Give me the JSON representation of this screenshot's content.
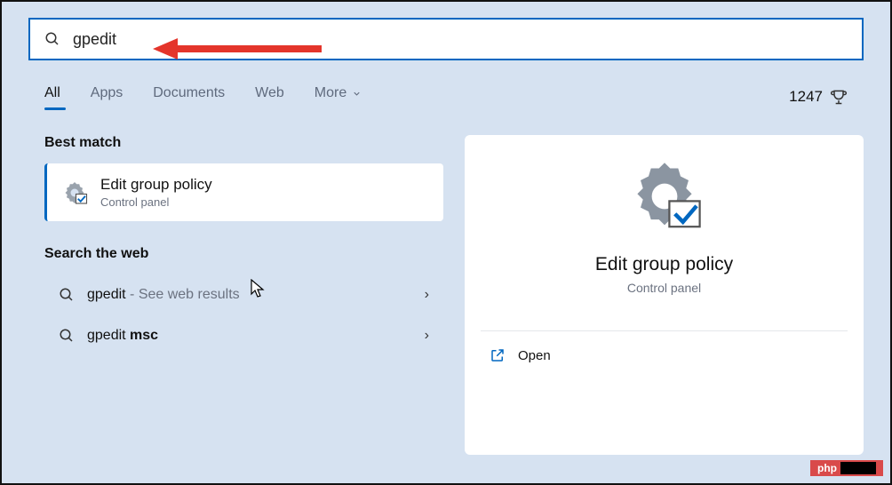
{
  "search": {
    "value": "gpedit"
  },
  "tabs": {
    "items": [
      {
        "label": "All",
        "active": true
      },
      {
        "label": "Apps"
      },
      {
        "label": "Documents"
      },
      {
        "label": "Web"
      }
    ],
    "more": "More"
  },
  "points": "1247",
  "sections": {
    "best_match": "Best match",
    "search_web": "Search the web"
  },
  "best": {
    "title": "Edit group policy",
    "subtitle": "Control panel"
  },
  "web_results": [
    {
      "prefix": "gpedit",
      "suffix": " - See web results",
      "bold_suffix": ""
    },
    {
      "prefix": "gpedit ",
      "suffix": "",
      "bold_suffix": "msc"
    }
  ],
  "preview": {
    "title": "Edit group policy",
    "subtitle": "Control panel",
    "open": "Open"
  },
  "badge": "php"
}
